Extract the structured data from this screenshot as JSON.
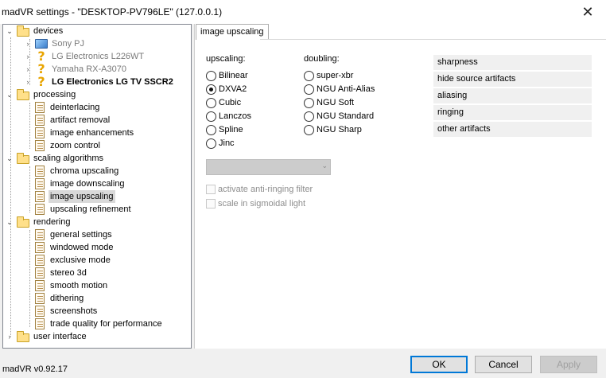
{
  "window": {
    "title": "madVR settings - \"DESKTOP-PV796LE\" (127.0.0.1)",
    "close_glyph": "✕"
  },
  "tree": {
    "devices": {
      "label": "devices",
      "children": [
        {
          "label": "Sony PJ"
        },
        {
          "label": "LG Electronics L226WT"
        },
        {
          "label": "Yamaha RX-A3070"
        },
        {
          "label": "LG Electronics LG TV SSCR2"
        }
      ]
    },
    "processing": {
      "label": "processing",
      "children": [
        {
          "label": "deinterlacing"
        },
        {
          "label": "artifact removal"
        },
        {
          "label": "image enhancements"
        },
        {
          "label": "zoom control"
        }
      ]
    },
    "scaling": {
      "label": "scaling algorithms",
      "children": [
        {
          "label": "chroma upscaling"
        },
        {
          "label": "image downscaling"
        },
        {
          "label": "image upscaling"
        },
        {
          "label": "upscaling refinement"
        }
      ]
    },
    "rendering": {
      "label": "rendering",
      "children": [
        {
          "label": "general settings"
        },
        {
          "label": "windowed mode"
        },
        {
          "label": "exclusive mode"
        },
        {
          "label": "stereo 3d"
        },
        {
          "label": "smooth motion"
        },
        {
          "label": "dithering"
        },
        {
          "label": "screenshots"
        },
        {
          "label": "trade quality for performance"
        }
      ]
    },
    "ui": {
      "label": "user interface"
    }
  },
  "panel": {
    "tab_label": "image upscaling",
    "upscaling": {
      "label": "upscaling:",
      "options": [
        "Bilinear",
        "DXVA2",
        "Cubic",
        "Lanczos",
        "Spline",
        "Jinc"
      ],
      "selected": "DXVA2"
    },
    "doubling": {
      "label": "doubling:",
      "options": [
        "super-xbr",
        "NGU Anti-Alias",
        "NGU Soft",
        "NGU Standard",
        "NGU Sharp"
      ]
    },
    "artifacts": [
      "sharpness",
      "hide source artifacts",
      "aliasing",
      "ringing",
      "other artifacts"
    ],
    "combo_value": "",
    "checkboxes": [
      "activate anti-ringing filter",
      "scale in sigmoidal light"
    ]
  },
  "footer": {
    "version": "madVR v0.92.17",
    "ok": "OK",
    "cancel": "Cancel",
    "apply": "Apply"
  }
}
